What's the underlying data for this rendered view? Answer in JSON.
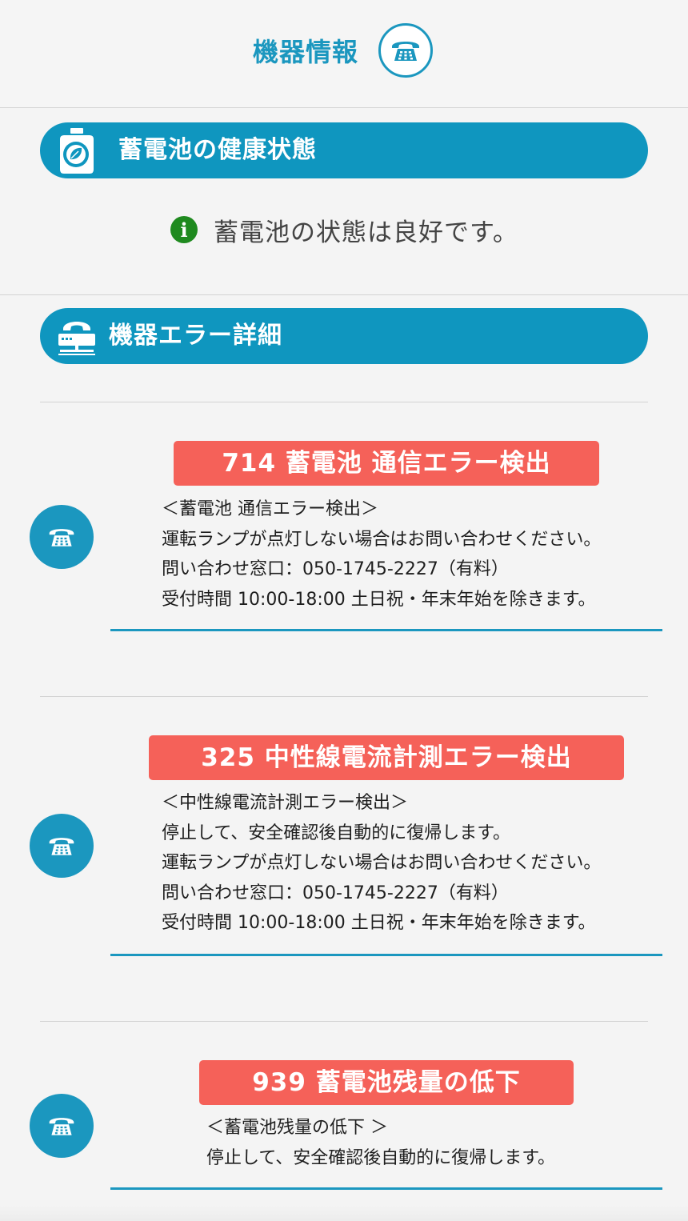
{
  "header": {
    "title": "機器情報",
    "phone_icon": "phone-icon"
  },
  "battery_section": {
    "title": "蓄電池の健康状態",
    "icon": "battery-leaf-icon",
    "status_icon": "info-icon",
    "status_icon_glyph": "i",
    "status_text": "蓄電池の状態は良好です。"
  },
  "error_section": {
    "title": "機器エラー詳細",
    "icon": "device-router-icon",
    "errors": [
      {
        "badge": "714 蓄電池 通信エラー検出",
        "lines": [
          "＜蓄電池 通信エラー検出＞",
          "運転ランプが点灯しない場合はお問い合わせください。",
          "問い合わせ窓口：050-1745-2227（有料）",
          "受付時間 10:00-18:00 土日祝・年末年始を除きます。"
        ]
      },
      {
        "badge": "325 中性線電流計測エラー検出",
        "lines": [
          "＜中性線電流計測エラー検出＞",
          "停止して、安全確認後自動的に復帰します。",
          "運転ランプが点灯しない場合はお問い合わせください。",
          "問い合わせ窓口：050-1745-2227（有料）",
          "受付時間 10:00-18:00 土日祝・年末年始を除きます。"
        ]
      },
      {
        "badge": "939 蓄電池残量の低下",
        "lines": [
          "＜蓄電池残量の低下 ＞",
          "停止して、安全確認後自動的に復帰します。"
        ]
      }
    ]
  },
  "colors": {
    "accent": "#1b97bf",
    "banner": "#0f96bf",
    "error_badge": "#f56159",
    "info_green": "#1f8a1f"
  }
}
